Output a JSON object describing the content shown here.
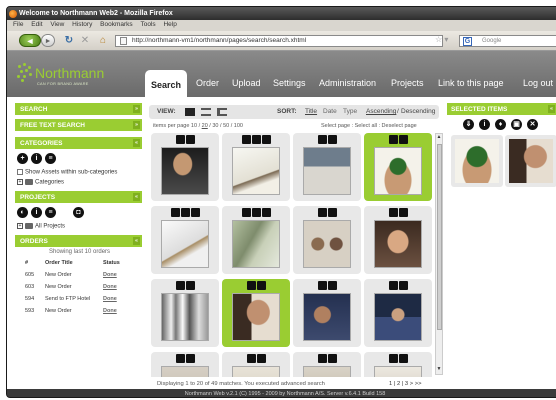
{
  "window": {
    "title": "Welcome to Northmann Web2 - Mozilla Firefox"
  },
  "menubar": {
    "items": [
      "File",
      "Edit",
      "View",
      "History",
      "Bookmarks",
      "Tools",
      "Help"
    ]
  },
  "navbar": {
    "url": "http://northmann-vm1/northmann/pages/search/search.xhtml",
    "search_placeholder": "Google",
    "back_icon": "back-arrow-icon",
    "forward_icon": "forward-arrow-icon"
  },
  "app": {
    "logo": {
      "name": "Northmann",
      "tagline": "CAN FOR BRAND AWARE"
    },
    "tabs": [
      "Search",
      "Order",
      "Upload",
      "Settings",
      "Administration",
      "Projects",
      "Link to this page",
      "Log out"
    ],
    "active_tab": "Search",
    "accent_color": "#9acd32"
  },
  "sidebar": {
    "search_label": "SEARCH",
    "freetext_label": "FREE TEXT SEARCH",
    "categories_label": "CATEGORIES",
    "categories_checkbox": "Show Assets within sub-categories",
    "categories_tree": "Categories",
    "projects_label": "PROJECTS",
    "projects_tree": "All Projects",
    "orders_label": "ORDERS",
    "orders_caption": "Showing last 10 orders",
    "orders_headers": [
      "#",
      "Order Title",
      "Status"
    ],
    "orders_rows": [
      {
        "id": "605",
        "title": "New Order",
        "status": "Done"
      },
      {
        "id": "603",
        "title": "New Order",
        "status": "Done"
      },
      {
        "id": "594",
        "title": "Send to FTP Hotel",
        "status": "Done"
      },
      {
        "id": "593",
        "title": "New Order",
        "status": "Done"
      }
    ]
  },
  "toolbar": {
    "view_label": "VIEW:",
    "sort_label": "SORT:",
    "sort_options": [
      "Title",
      "Date",
      "Type"
    ],
    "sort_ascending": "Ascending",
    "sort_sep": "/",
    "sort_descending": "Descending",
    "per_page_label": "items per page",
    "per_page_options": [
      "10",
      "20",
      "30",
      "50",
      "100"
    ],
    "per_page_selected": "20",
    "select_actions": "Select page : Select all : Deselect page"
  },
  "results": {
    "matches_text": "Displaying 1 to 20 of 49 matches. You executed advanced search",
    "pages": "1 | 2 | 3 > >>",
    "selected_tiles": [
      3,
      9
    ],
    "tile_count": 16
  },
  "selected_panel": {
    "label": "SELECTED ITEMS",
    "count": 2
  },
  "footer": {
    "text": "Northmann Web v.2.1 (C) 1995 - 2009 by Northmann A/S. Server v.6.4.1 Build 158"
  }
}
